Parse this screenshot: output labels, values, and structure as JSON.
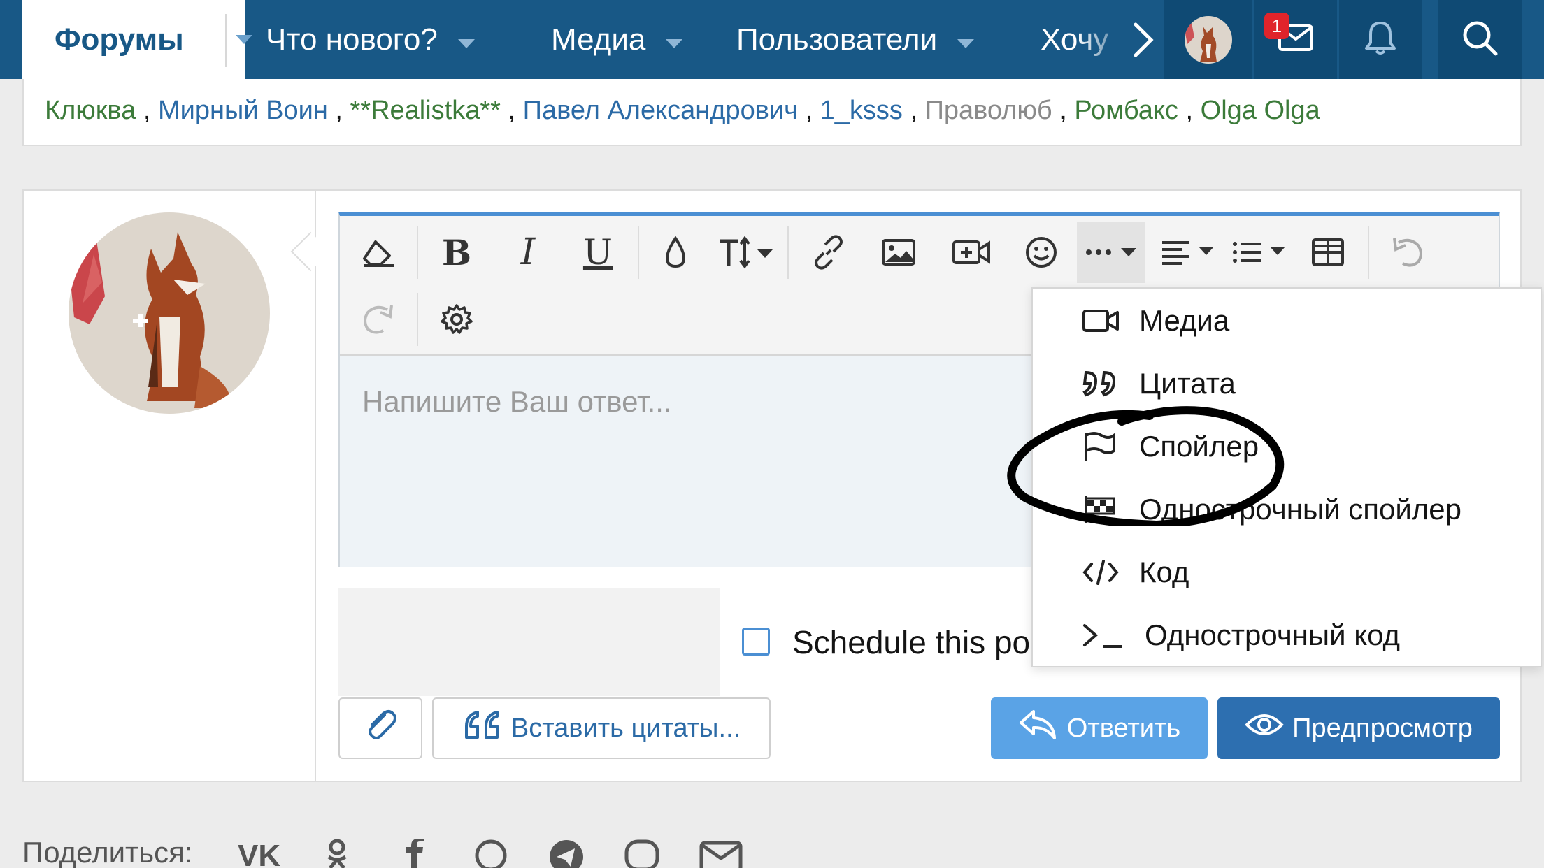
{
  "nav": {
    "forums_label": "Форумы",
    "items": [
      {
        "label": "Что нового?"
      },
      {
        "label": "Медиа"
      },
      {
        "label": "Пользователи"
      },
      {
        "label": "Хочу"
      }
    ],
    "inbox_badge": "1",
    "icons": [
      "chevron-right-icon",
      "avatar",
      "envelope-icon",
      "bell-icon",
      "search-icon"
    ]
  },
  "online_users": [
    {
      "name": "Клюква",
      "color": "#3c7b3a"
    },
    {
      "name": "Мирный Воин",
      "color": "#2b6aa6"
    },
    {
      "name": "**Realistka**",
      "color": "#3c7b3a"
    },
    {
      "name": "Павел Александрович",
      "color": "#2b6aa6"
    },
    {
      "name": "1_ksss",
      "color": "#2b6aa6"
    },
    {
      "name": "Праволюб",
      "color": "#8a8a8a"
    },
    {
      "name": "Ромбакс",
      "color": "#3c7b3a"
    },
    {
      "name": "Olga Olga",
      "color": "#3c7b3a"
    }
  ],
  "editor": {
    "placeholder": "Напишите Ваш ответ...",
    "toolbar_icons": [
      "eraser-icon",
      "bold-icon",
      "italic-icon",
      "underline-icon",
      "color-drop-icon",
      "text-size-icon",
      "link-icon",
      "image-icon",
      "video-icon",
      "smiley-icon",
      "more-icon",
      "align-icon",
      "list-icon",
      "table-icon",
      "undo-icon",
      "redo-icon",
      "settings-icon"
    ]
  },
  "insert_menu": {
    "items": [
      {
        "label": "Медиа",
        "icon": "video-camera-icon"
      },
      {
        "label": "Цитата",
        "icon": "quote-icon"
      },
      {
        "label": "Спойлер",
        "icon": "flag-icon"
      },
      {
        "label": "Однострочный спойлер",
        "icon": "checkered-flag-icon"
      },
      {
        "label": "Код",
        "icon": "code-icon"
      },
      {
        "label": "Однострочный код",
        "icon": "terminal-icon"
      }
    ]
  },
  "schedule": {
    "label": "Schedule this post"
  },
  "buttons": {
    "insert_quotes": "Вставить цитаты...",
    "reply": "Ответить",
    "preview": "Предпросмотр"
  },
  "share": {
    "label": "Поделиться:"
  },
  "colors": {
    "nav": "#185886",
    "accent": "#4b8fd3",
    "reply": "#5aa3e6",
    "preview": "#2d6fb0"
  }
}
